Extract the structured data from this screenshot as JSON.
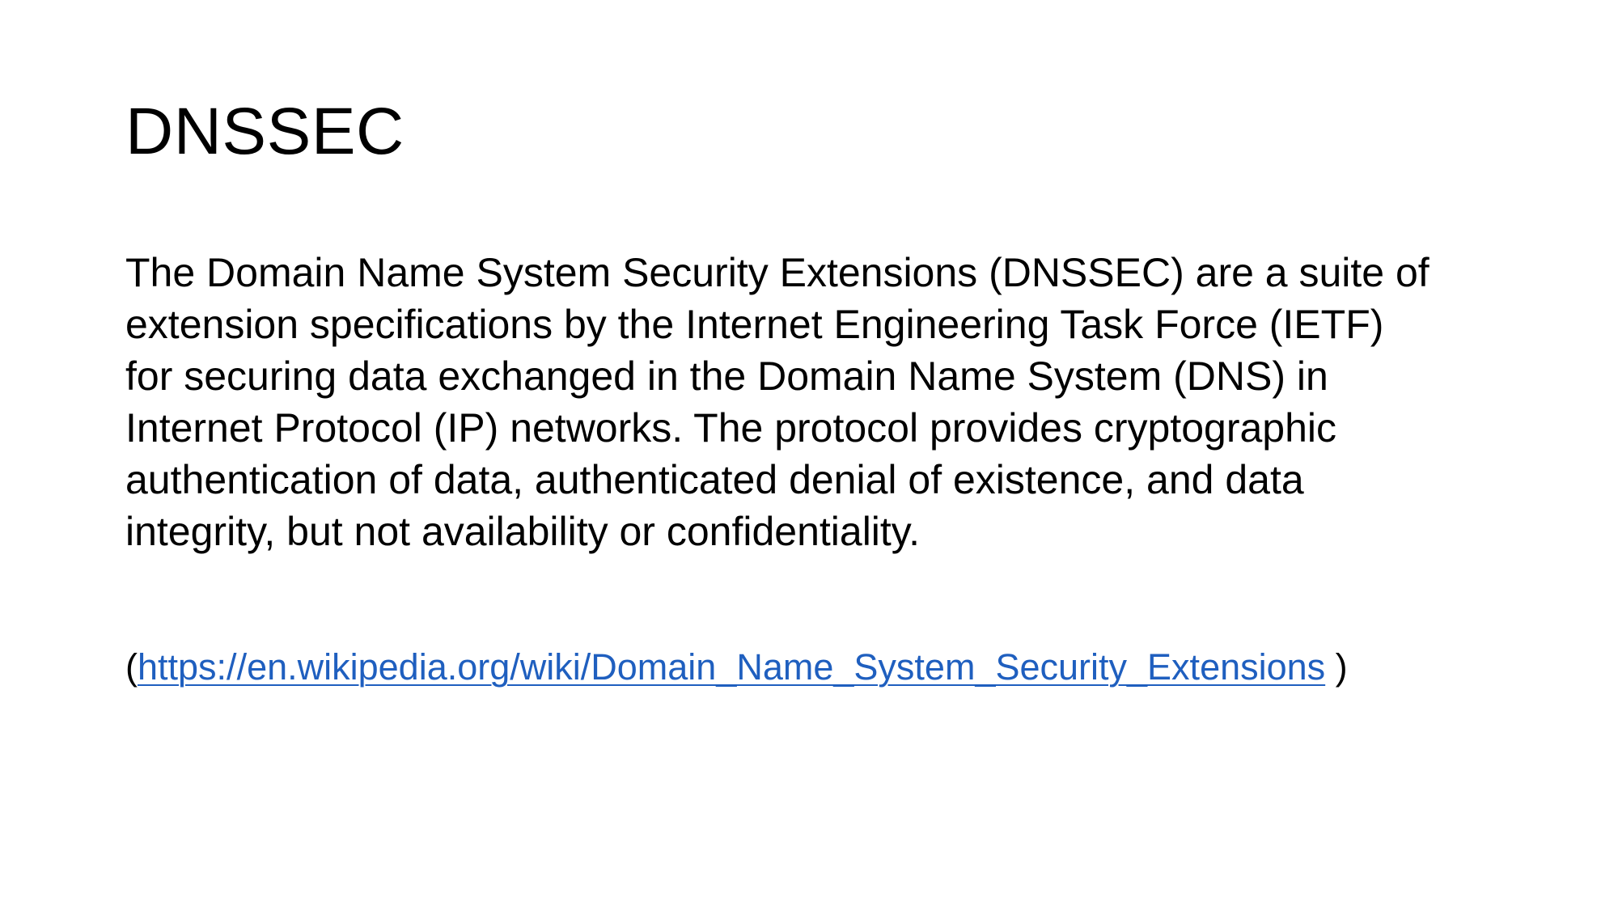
{
  "slide": {
    "title": "DNSSEC",
    "body_lines": [
      "The Domain Name System Security Extensions (DNSSEC) are a suite of",
      "extension specifications by the Internet Engineering Task Force (IETF)",
      "for securing data exchanged in the Domain Name System (DNS) in",
      "Internet Protocol (IP) networks. The protocol provides cryptographic",
      "authentication of data, authenticated denial of existence, and data",
      "integrity, but not availability or confidentiality."
    ],
    "citation": {
      "open_paren": "(",
      "link_text": "https://en.wikipedia.org/wiki/Domain_Name_System_Security_Extensions",
      "close_paren": " )"
    }
  },
  "colors": {
    "background": "#ffffff",
    "text": "#000000",
    "link": "#1f5fbf"
  }
}
